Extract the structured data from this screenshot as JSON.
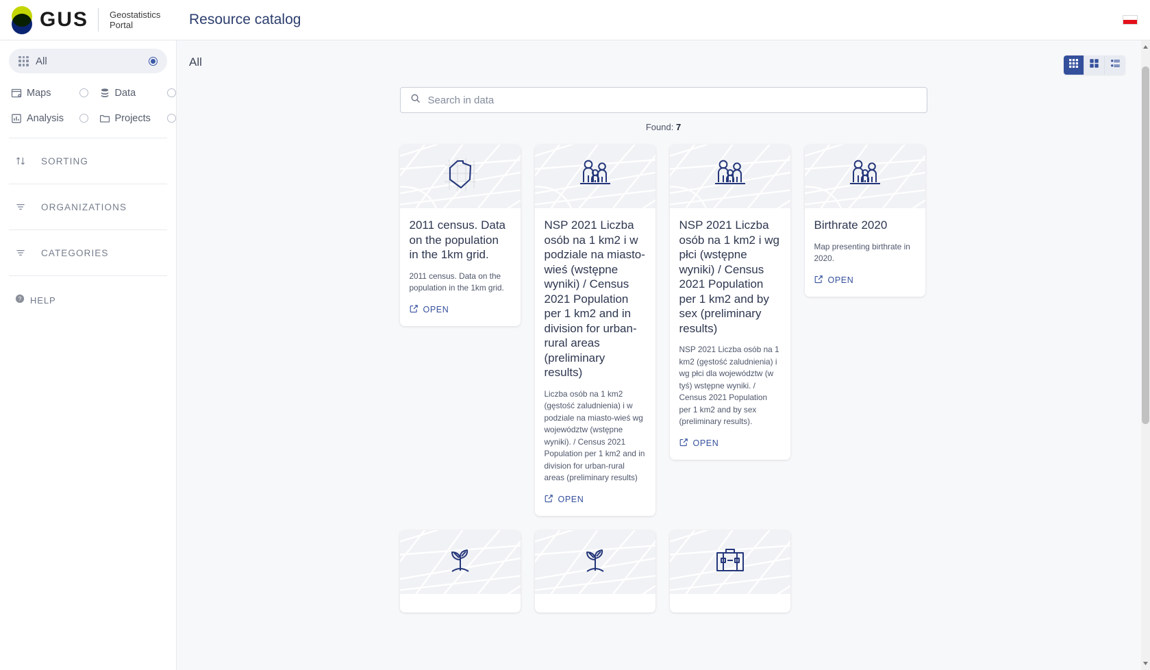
{
  "header": {
    "logo_text": "GUS",
    "portal_name": "Geostatistics Portal",
    "page_title": "Resource catalog",
    "language_flag": "poland-flag"
  },
  "sidebar": {
    "all_item": {
      "label": "All",
      "icon": "grid-icon",
      "selected": true
    },
    "nav_items": [
      {
        "label": "Maps",
        "icon": "map-icon",
        "selected": false
      },
      {
        "label": "Data",
        "icon": "database-icon",
        "selected": false
      },
      {
        "label": "Analysis",
        "icon": "bar-chart-icon",
        "selected": false
      },
      {
        "label": "Projects",
        "icon": "folder-icon",
        "selected": false
      }
    ],
    "sections": [
      {
        "label": "SORTING",
        "icon": "sort-arrows-icon"
      },
      {
        "label": "ORGANIZATIONS",
        "icon": "filter-icon"
      },
      {
        "label": "CATEGORIES",
        "icon": "filter-icon"
      }
    ],
    "help": {
      "label": "HELP",
      "icon": "help-circle-icon"
    }
  },
  "main": {
    "breadcrumb": "All",
    "view_toggle": [
      {
        "name": "grid-9-view",
        "icon": "grid-9-icon",
        "active": true
      },
      {
        "name": "grid-4-view",
        "icon": "grid-4-icon",
        "active": false
      },
      {
        "name": "list-view",
        "icon": "list-icon",
        "active": false
      }
    ],
    "search": {
      "placeholder": "Search in data",
      "value": "",
      "icon": "search-icon"
    },
    "found_label": "Found:",
    "found_count": "7",
    "open_label": "OPEN",
    "open_icon": "external-link-icon",
    "cards": [
      {
        "icon": "region-polygon-icon",
        "title": "2011 census. Data on the population in the 1km grid.",
        "description": "2011 census. Data on the population in the 1km grid."
      },
      {
        "icon": "family-people-icon",
        "title": "NSP 2021 Liczba osób na 1 km2 i w podziale na miasto-wieś (wstępne wyniki) / Census 2021 Population per 1 km2 and in division for urban-rural areas (preliminary results)",
        "description": "Liczba osób na 1 km2 (gęstość zaludnienia) i w podziale na miasto-wieś wg województw (wstępne wyniki). / Census 2021 Population per 1 km2 and in division for urban-rural areas (preliminary results)"
      },
      {
        "icon": "family-people-icon",
        "title": "NSP 2021 Liczba osób na 1 km2 i wg płci (wstępne wyniki) / Census 2021 Population per 1 km2 and by sex (preliminary results)",
        "description": "NSP 2021 Liczba osób na 1 km2 (gęstość zaludnienia) i wg płci dla województw (w tyś) wstępne wyniki. / Census 2021 Population per 1 km2 and by sex (preliminary results)."
      },
      {
        "icon": "family-people-icon",
        "title": "Birthrate 2020",
        "description": "Map presenting birthrate in 2020."
      }
    ],
    "cards_row2": [
      {
        "icon": "seedling-icon"
      },
      {
        "icon": "seedling-icon"
      },
      {
        "icon": "briefcase-icon"
      }
    ]
  },
  "colors": {
    "accent": "#34509c",
    "brand_lime": "#c3d600",
    "brand_navy": "#0a2472",
    "title_blue": "#2c3e6e"
  }
}
